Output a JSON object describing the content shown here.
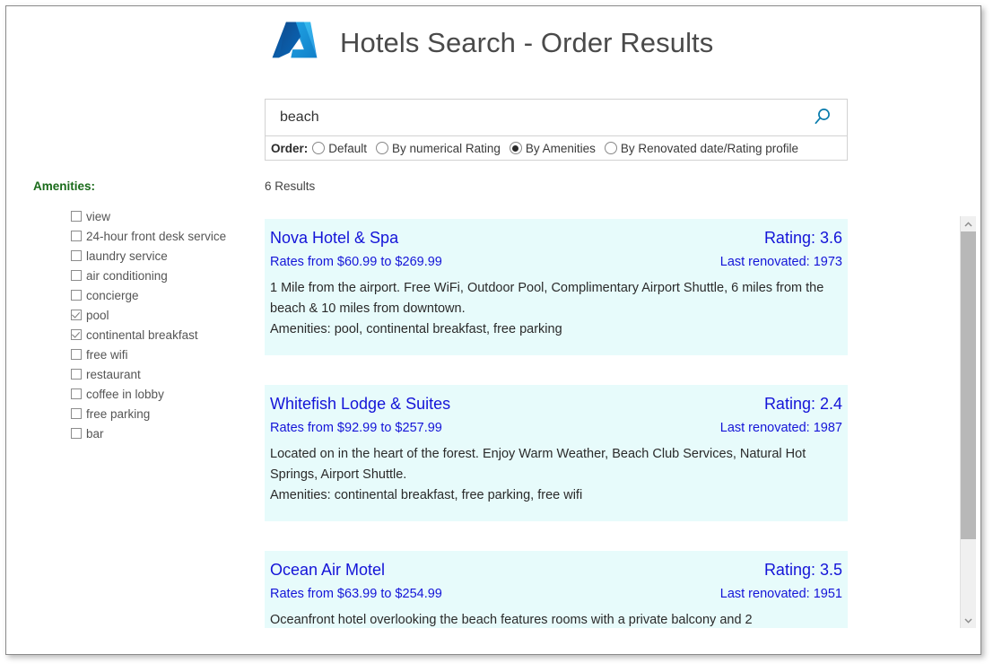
{
  "app": {
    "title": "Hotels Search - Order Results",
    "logo_icon": "azure-logo-icon"
  },
  "search": {
    "value": "beach",
    "placeholder": "",
    "search_icon": "search-icon",
    "order_label": "Order:",
    "order_options": [
      {
        "label": "Default",
        "selected": false
      },
      {
        "label": "By numerical Rating",
        "selected": false
      },
      {
        "label": "By Amenities",
        "selected": true
      },
      {
        "label": "By Renovated date/Rating profile",
        "selected": false
      }
    ]
  },
  "sidebar": {
    "title": "Amenities:",
    "items": [
      {
        "label": "view",
        "checked": false
      },
      {
        "label": "24-hour front desk service",
        "checked": false
      },
      {
        "label": "laundry service",
        "checked": false
      },
      {
        "label": "air conditioning",
        "checked": false
      },
      {
        "label": "concierge",
        "checked": false
      },
      {
        "label": "pool",
        "checked": true
      },
      {
        "label": "continental breakfast",
        "checked": true
      },
      {
        "label": "free wifi",
        "checked": false
      },
      {
        "label": "restaurant",
        "checked": false
      },
      {
        "label": "coffee in lobby",
        "checked": false
      },
      {
        "label": "free parking",
        "checked": false
      },
      {
        "label": "bar",
        "checked": false
      }
    ]
  },
  "results": {
    "count_text": "6 Results",
    "cards": [
      {
        "name": "Nova Hotel & Spa",
        "rating": "Rating: 3.6",
        "rates": "Rates from $60.99 to $269.99",
        "renovated": "Last renovated: 1973",
        "description": "1 Mile from the airport.  Free WiFi, Outdoor Pool, Complimentary Airport Shuttle, 6 miles from the beach & 10 miles from downtown.",
        "amenities": "Amenities: pool, continental breakfast, free parking"
      },
      {
        "name": "Whitefish Lodge & Suites",
        "rating": "Rating: 2.4",
        "rates": "Rates from $92.99 to $257.99",
        "renovated": "Last renovated: 1987",
        "description": "Located on in the heart of the forest. Enjoy Warm Weather, Beach Club Services, Natural Hot Springs, Airport Shuttle.",
        "amenities": "Amenities: continental breakfast, free parking, free wifi"
      },
      {
        "name": "Ocean Air Motel",
        "rating": "Rating: 3.5",
        "rates": "Rates from $63.99 to $254.99",
        "renovated": "Last renovated: 1951",
        "description": "Oceanfront hotel overlooking the beach features rooms with a private balcony and 2",
        "amenities": ""
      }
    ]
  },
  "scrollbar": {
    "up_icon": "chevron-up-icon",
    "down_icon": "chevron-down-icon"
  },
  "colors": {
    "link": "#1414d8",
    "card_bg": "#e7fbfb",
    "amenities_heading": "#1a6b1a",
    "search_icon": "#0a7cad",
    "title": "#4a4a4a"
  }
}
